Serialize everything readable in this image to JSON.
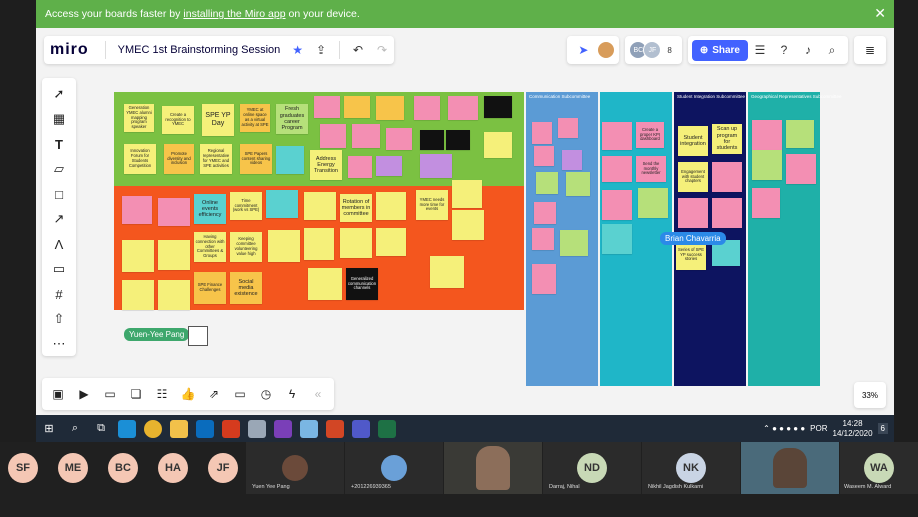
{
  "banner": {
    "text_before": "Access your boards faster by",
    "link": "installing the Miro app",
    "text_after": "on your device.",
    "close": "✕"
  },
  "app": {
    "logo": "miro",
    "board_title": "YMEC 1st Brainstorming Session"
  },
  "collab": {
    "initials": [
      "BC",
      "JF"
    ],
    "count": "8",
    "share_label": "Share"
  },
  "zoom": "33%",
  "frames": {
    "orange_group_label": "Yuen-Yee Pang",
    "col1": "Communication Subcommittee",
    "col2": "Student Integration Subcommittee",
    "col3": "Geographical Representatives Subcommittee",
    "col_blue_title": ""
  },
  "notes": [
    {
      "t": "Generation YMEC alumni mapping program speaker"
    },
    {
      "t": "Create a recognition to YMEC"
    },
    {
      "t": "SPE YP Day"
    },
    {
      "t": "YMEC at online space as a virtual activity at SPE"
    },
    {
      "t": "Fresh graduates career Program"
    },
    {
      "t": "Innovation Forum for Students Competition"
    },
    {
      "t": "Promote diversity and inclusion"
    },
    {
      "t": "Regional representative for YMEC and SPE activities"
    },
    {
      "t": "SPE Papers content sharing videos"
    },
    {
      "t": "Address Energy Transition"
    },
    {
      "t": "Online events efficiency"
    },
    {
      "t": "Time commitment (work vs SPE)"
    },
    {
      "t": "Having connection with other Committees & Groups"
    },
    {
      "t": "Keeping committee volunteering value high"
    },
    {
      "t": "Social media existence"
    },
    {
      "t": "SPE Finance Challenges"
    },
    {
      "t": "Rotation of members in committee"
    },
    {
      "t": "YMEC needs more time for events"
    },
    {
      "t": "Generalized communication channels"
    },
    {
      "t": "Engagement with student chapters"
    },
    {
      "t": "Student integration"
    },
    {
      "t": "Scan up program for students"
    },
    {
      "t": "Create a proper KPI dashboard"
    },
    {
      "t": "Send the monthly newsletter"
    },
    {
      "t": "Series of SPE YP success stories"
    }
  ],
  "cursors": {
    "c1": "Brian Chavarria",
    "c2": "Yuen-Yee Pang"
  },
  "taskbar": {
    "lang": "POR",
    "time": "14:28",
    "date": "14/12/2020",
    "notif": "6"
  },
  "participants": [
    {
      "initials": "SF",
      "color": "#f4c7b4"
    },
    {
      "initials": "ME",
      "color": "#f4c7b4"
    },
    {
      "initials": "BC",
      "color": "#f4c7b4"
    },
    {
      "initials": "HA",
      "color": "#f4c7b4"
    },
    {
      "initials": "JF",
      "color": "#f4c7b4"
    }
  ],
  "video_tiles": [
    {
      "name": "Yuen Yee Pang"
    },
    {
      "name": "+201226939365"
    },
    {
      "name": ""
    },
    {
      "name": "Darraj, Nihal",
      "initials": "ND",
      "color": "#c8d9b6"
    },
    {
      "name": "Nikhil Jagdish Kulkarni",
      "initials": "NK",
      "color": "#c9d4e4"
    },
    {
      "name": ""
    },
    {
      "name": "Waseem M. Alward",
      "initials": "WA",
      "color": "#c8d9b6"
    }
  ]
}
